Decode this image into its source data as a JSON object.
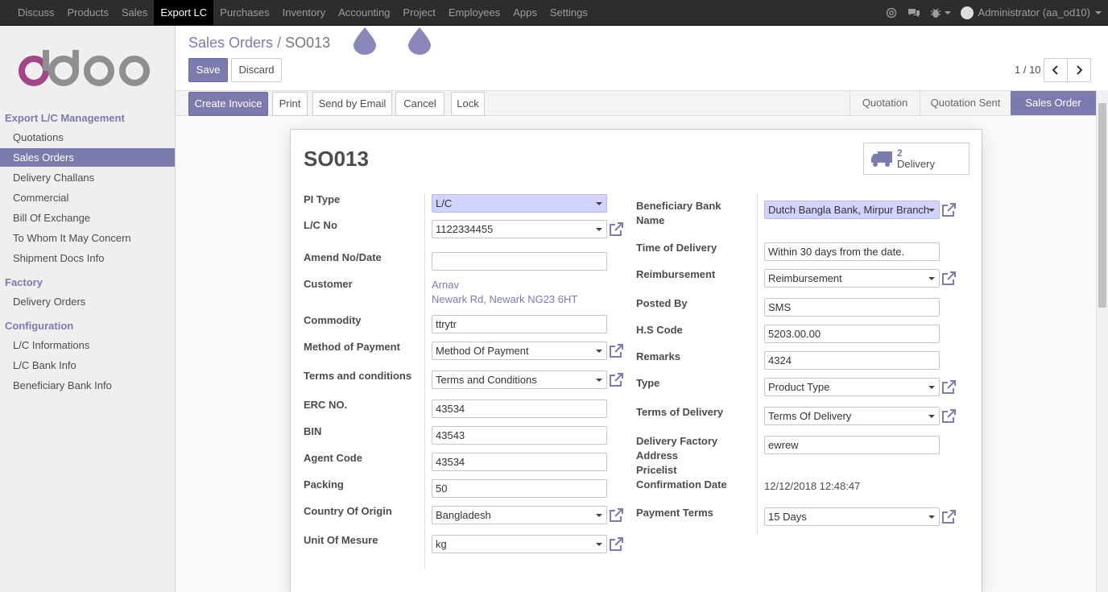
{
  "topmenu": [
    "Discuss",
    "Products",
    "Sales",
    "Export LC",
    "Purchases",
    "Inventory",
    "Accounting",
    "Project",
    "Employees",
    "Apps",
    "Settings"
  ],
  "user": "Administrator (aa_od10)",
  "sidebar": {
    "sections": [
      {
        "title": "Export L/C Management",
        "items": [
          "Quotations",
          "Sales Orders",
          "Delivery Challans",
          "Commercial",
          "Bill Of Exchange",
          "To Whom It May Concern",
          "Shipment Docs Info"
        ]
      },
      {
        "title": "Factory",
        "items": [
          "Delivery Orders"
        ]
      },
      {
        "title": "Configuration",
        "items": [
          "L/C Informations",
          "L/C Bank Info",
          "Beneficiary Bank Info"
        ]
      }
    ],
    "active_item": "Sales Orders"
  },
  "breadcrumb": {
    "parent": "Sales Orders",
    "sep": "/",
    "current": "SO013"
  },
  "buttons": {
    "save": "Save",
    "discard": "Discard"
  },
  "pager": {
    "value": "1 / 10"
  },
  "header_buttons": {
    "create_invoice": "Create Invoice",
    "print": "Print",
    "send_email": "Send by Email",
    "cancel": "Cancel",
    "lock": "Lock"
  },
  "stages": [
    "Quotation",
    "Quotation Sent",
    "Sales Order"
  ],
  "active_stage": "Sales Order",
  "doc": {
    "name": "SO013"
  },
  "smart_button": {
    "count": "2",
    "label": "Delivery"
  },
  "left_fields": {
    "pi_type": {
      "label": "PI Type",
      "value": "L/C"
    },
    "lc_no": {
      "label": "L/C No",
      "value": "1122334455"
    },
    "amend": {
      "label": "Amend No/Date",
      "value": ""
    },
    "customer": {
      "label": "Customer",
      "name": "Arnav",
      "address": "Newark Rd, Newark NG23 6HT"
    },
    "commodity": {
      "label": "Commodity",
      "value": "ttrytr"
    },
    "method_payment": {
      "label": "Method of Payment",
      "value": "Method Of Payment"
    },
    "terms": {
      "label": "Terms and conditions",
      "value": "Terms and Conditions"
    },
    "erc": {
      "label": "ERC NO.",
      "value": "43534"
    },
    "bin": {
      "label": "BIN",
      "value": "43543"
    },
    "agent": {
      "label": "Agent Code",
      "value": "43534"
    },
    "packing": {
      "label": "Packing",
      "value": "50"
    },
    "country": {
      "label": "Country Of Origin",
      "value": "Bangladesh"
    },
    "uom": {
      "label": "Unit Of Mesure",
      "value": "kg"
    }
  },
  "right_fields": {
    "bank_label_1": "Beneficiary Bank",
    "bank_label_2": "Name",
    "bank_value": "Dutch Bangla Bank, Mirpur Branch",
    "time_delivery": {
      "label": "Time of Delivery",
      "value": "Within 30 days from the date."
    },
    "reimbursement": {
      "label": "Reimbursement",
      "value": "Reimbursement"
    },
    "posted_by": {
      "label": "Posted By",
      "value": "SMS"
    },
    "hs_code": {
      "label": "H.S Code",
      "value": "5203.00.00"
    },
    "remarks": {
      "label": "Remarks",
      "value": "4324"
    },
    "type": {
      "label": "Type",
      "value": "Product Type"
    },
    "terms_delivery": {
      "label": "Terms of Delivery",
      "value": "Terms Of Delivery"
    },
    "factory_label_1": "Delivery Factory",
    "factory_label_2": "Address",
    "factory_value": "ewrew",
    "pricelist": {
      "label": "Pricelist"
    },
    "confirmation": {
      "label": "Confirmation Date",
      "value": "12/12/2018 12:48:47"
    },
    "payment_terms": {
      "label": "Payment Terms",
      "value": "15 Days"
    }
  },
  "colors": {
    "brand": "#7c7bad",
    "logo_o": "#a24689",
    "logo_gray": "#8f8f8f",
    "topbar": "#2d2d2d"
  }
}
